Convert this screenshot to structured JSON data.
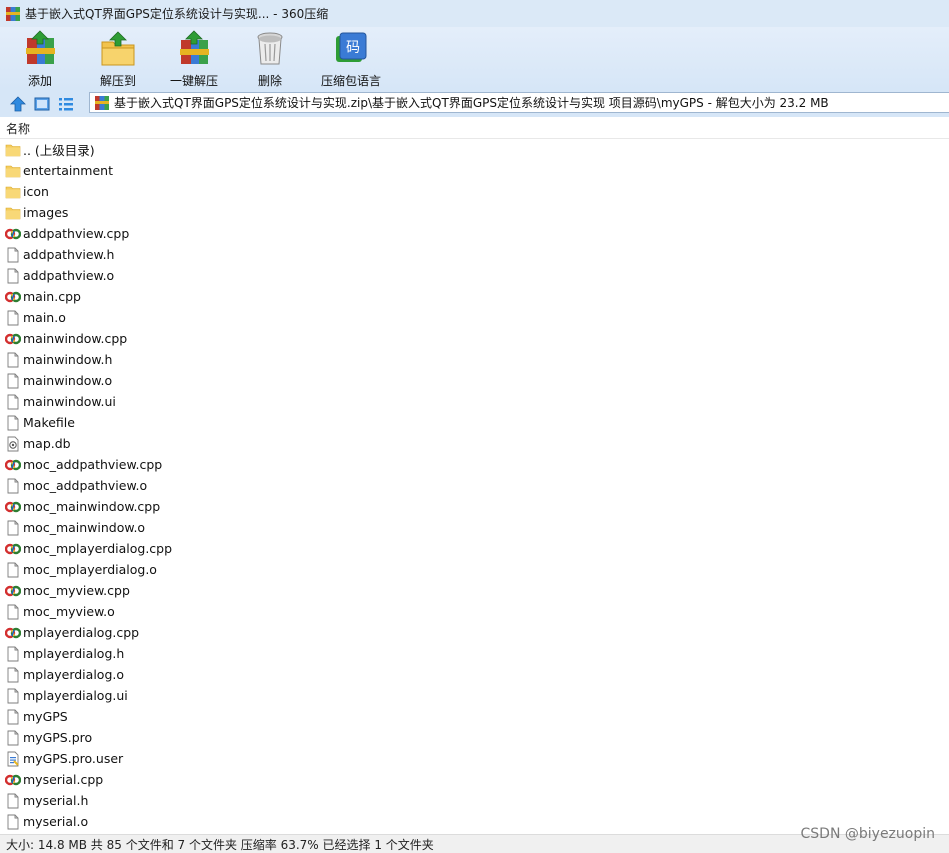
{
  "window": {
    "title": "基于嵌入式QT界面GPS定位系统设计与实现... - 360压缩"
  },
  "toolbar": {
    "buttons": [
      {
        "label": "添加",
        "icon": "add-archive-icon"
      },
      {
        "label": "解压到",
        "icon": "extract-to-icon"
      },
      {
        "label": "一键解压",
        "icon": "one-click-extract-icon"
      },
      {
        "label": "删除",
        "icon": "delete-trash-icon"
      },
      {
        "label": "压缩包语言",
        "icon": "archive-language-icon"
      }
    ]
  },
  "address": {
    "path": "基于嵌入式QT界面GPS定位系统设计与实现.zip\\基于嵌入式QT界面GPS定位系统设计与实现 项目源码\\myGPS - 解包大小为 23.2 MB"
  },
  "list": {
    "column_name": "名称",
    "files": [
      {
        "name": ".. (上级目录)",
        "type": "folder"
      },
      {
        "name": "entertainment",
        "type": "folder"
      },
      {
        "name": "icon",
        "type": "folder"
      },
      {
        "name": "images",
        "type": "folder"
      },
      {
        "name": "addpathview.cpp",
        "type": "cpp"
      },
      {
        "name": "addpathview.h",
        "type": "file"
      },
      {
        "name": "addpathview.o",
        "type": "file"
      },
      {
        "name": "main.cpp",
        "type": "cpp"
      },
      {
        "name": "main.o",
        "type": "file"
      },
      {
        "name": "mainwindow.cpp",
        "type": "cpp"
      },
      {
        "name": "mainwindow.h",
        "type": "file"
      },
      {
        "name": "mainwindow.o",
        "type": "file"
      },
      {
        "name": "mainwindow.ui",
        "type": "file"
      },
      {
        "name": "Makefile",
        "type": "file"
      },
      {
        "name": "map.db",
        "type": "db"
      },
      {
        "name": "moc_addpathview.cpp",
        "type": "cpp"
      },
      {
        "name": "moc_addpathview.o",
        "type": "file"
      },
      {
        "name": "moc_mainwindow.cpp",
        "type": "cpp"
      },
      {
        "name": "moc_mainwindow.o",
        "type": "file"
      },
      {
        "name": "moc_mplayerdialog.cpp",
        "type": "cpp"
      },
      {
        "name": "moc_mplayerdialog.o",
        "type": "file"
      },
      {
        "name": "moc_myview.cpp",
        "type": "cpp"
      },
      {
        "name": "moc_myview.o",
        "type": "file"
      },
      {
        "name": "mplayerdialog.cpp",
        "type": "cpp"
      },
      {
        "name": "mplayerdialog.h",
        "type": "file"
      },
      {
        "name": "mplayerdialog.o",
        "type": "file"
      },
      {
        "name": "mplayerdialog.ui",
        "type": "file"
      },
      {
        "name": "myGPS",
        "type": "file"
      },
      {
        "name": "myGPS.pro",
        "type": "file"
      },
      {
        "name": "myGPS.pro.user",
        "type": "user"
      },
      {
        "name": "myserial.cpp",
        "type": "cpp"
      },
      {
        "name": "myserial.h",
        "type": "file"
      },
      {
        "name": "myserial.o",
        "type": "file"
      }
    ]
  },
  "status": {
    "text": "大小: 14.8 MB 共 85 个文件和 7 个文件夹 压缩率 63.7% 已经选择 1 个文件夹"
  },
  "watermark": {
    "text": "CSDN @biyezuopin"
  }
}
